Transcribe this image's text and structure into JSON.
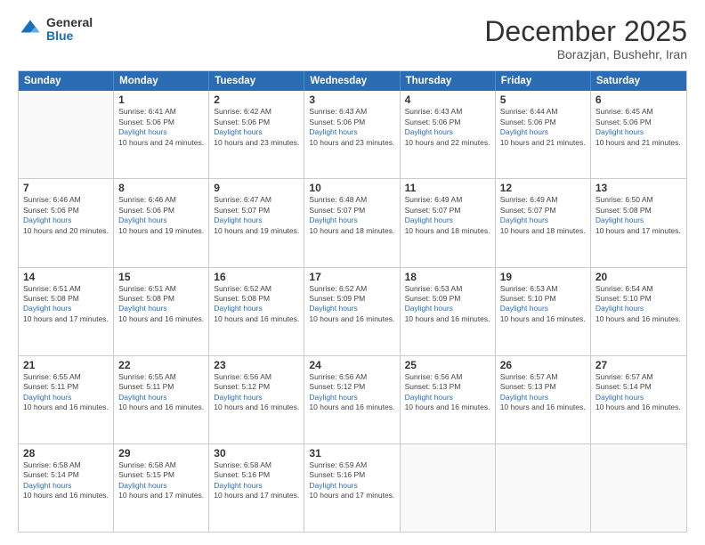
{
  "header": {
    "logo_general": "General",
    "logo_blue": "Blue",
    "month": "December 2025",
    "location": "Borazjan, Bushehr, Iran"
  },
  "weekdays": [
    "Sunday",
    "Monday",
    "Tuesday",
    "Wednesday",
    "Thursday",
    "Friday",
    "Saturday"
  ],
  "weeks": [
    [
      {
        "day": "",
        "info": ""
      },
      {
        "day": "1",
        "sunrise": "6:41 AM",
        "sunset": "5:06 PM",
        "daylight": "10 hours and 24 minutes."
      },
      {
        "day": "2",
        "sunrise": "6:42 AM",
        "sunset": "5:06 PM",
        "daylight": "10 hours and 23 minutes."
      },
      {
        "day": "3",
        "sunrise": "6:43 AM",
        "sunset": "5:06 PM",
        "daylight": "10 hours and 23 minutes."
      },
      {
        "day": "4",
        "sunrise": "6:43 AM",
        "sunset": "5:06 PM",
        "daylight": "10 hours and 22 minutes."
      },
      {
        "day": "5",
        "sunrise": "6:44 AM",
        "sunset": "5:06 PM",
        "daylight": "10 hours and 21 minutes."
      },
      {
        "day": "6",
        "sunrise": "6:45 AM",
        "sunset": "5:06 PM",
        "daylight": "10 hours and 21 minutes."
      }
    ],
    [
      {
        "day": "7",
        "sunrise": "6:46 AM",
        "sunset": "5:06 PM",
        "daylight": "10 hours and 20 minutes."
      },
      {
        "day": "8",
        "sunrise": "6:46 AM",
        "sunset": "5:06 PM",
        "daylight": "10 hours and 19 minutes."
      },
      {
        "day": "9",
        "sunrise": "6:47 AM",
        "sunset": "5:07 PM",
        "daylight": "10 hours and 19 minutes."
      },
      {
        "day": "10",
        "sunrise": "6:48 AM",
        "sunset": "5:07 PM",
        "daylight": "10 hours and 18 minutes."
      },
      {
        "day": "11",
        "sunrise": "6:49 AM",
        "sunset": "5:07 PM",
        "daylight": "10 hours and 18 minutes."
      },
      {
        "day": "12",
        "sunrise": "6:49 AM",
        "sunset": "5:07 PM",
        "daylight": "10 hours and 18 minutes."
      },
      {
        "day": "13",
        "sunrise": "6:50 AM",
        "sunset": "5:08 PM",
        "daylight": "10 hours and 17 minutes."
      }
    ],
    [
      {
        "day": "14",
        "sunrise": "6:51 AM",
        "sunset": "5:08 PM",
        "daylight": "10 hours and 17 minutes."
      },
      {
        "day": "15",
        "sunrise": "6:51 AM",
        "sunset": "5:08 PM",
        "daylight": "10 hours and 16 minutes."
      },
      {
        "day": "16",
        "sunrise": "6:52 AM",
        "sunset": "5:08 PM",
        "daylight": "10 hours and 16 minutes."
      },
      {
        "day": "17",
        "sunrise": "6:52 AM",
        "sunset": "5:09 PM",
        "daylight": "10 hours and 16 minutes."
      },
      {
        "day": "18",
        "sunrise": "6:53 AM",
        "sunset": "5:09 PM",
        "daylight": "10 hours and 16 minutes."
      },
      {
        "day": "19",
        "sunrise": "6:53 AM",
        "sunset": "5:10 PM",
        "daylight": "10 hours and 16 minutes."
      },
      {
        "day": "20",
        "sunrise": "6:54 AM",
        "sunset": "5:10 PM",
        "daylight": "10 hours and 16 minutes."
      }
    ],
    [
      {
        "day": "21",
        "sunrise": "6:55 AM",
        "sunset": "5:11 PM",
        "daylight": "10 hours and 16 minutes."
      },
      {
        "day": "22",
        "sunrise": "6:55 AM",
        "sunset": "5:11 PM",
        "daylight": "10 hours and 16 minutes."
      },
      {
        "day": "23",
        "sunrise": "6:56 AM",
        "sunset": "5:12 PM",
        "daylight": "10 hours and 16 minutes."
      },
      {
        "day": "24",
        "sunrise": "6:56 AM",
        "sunset": "5:12 PM",
        "daylight": "10 hours and 16 minutes."
      },
      {
        "day": "25",
        "sunrise": "6:56 AM",
        "sunset": "5:13 PM",
        "daylight": "10 hours and 16 minutes."
      },
      {
        "day": "26",
        "sunrise": "6:57 AM",
        "sunset": "5:13 PM",
        "daylight": "10 hours and 16 minutes."
      },
      {
        "day": "27",
        "sunrise": "6:57 AM",
        "sunset": "5:14 PM",
        "daylight": "10 hours and 16 minutes."
      }
    ],
    [
      {
        "day": "28",
        "sunrise": "6:58 AM",
        "sunset": "5:14 PM",
        "daylight": "10 hours and 16 minutes."
      },
      {
        "day": "29",
        "sunrise": "6:58 AM",
        "sunset": "5:15 PM",
        "daylight": "10 hours and 17 minutes."
      },
      {
        "day": "30",
        "sunrise": "6:58 AM",
        "sunset": "5:16 PM",
        "daylight": "10 hours and 17 minutes."
      },
      {
        "day": "31",
        "sunrise": "6:59 AM",
        "sunset": "5:16 PM",
        "daylight": "10 hours and 17 minutes."
      },
      {
        "day": "",
        "info": ""
      },
      {
        "day": "",
        "info": ""
      },
      {
        "day": "",
        "info": ""
      }
    ]
  ]
}
